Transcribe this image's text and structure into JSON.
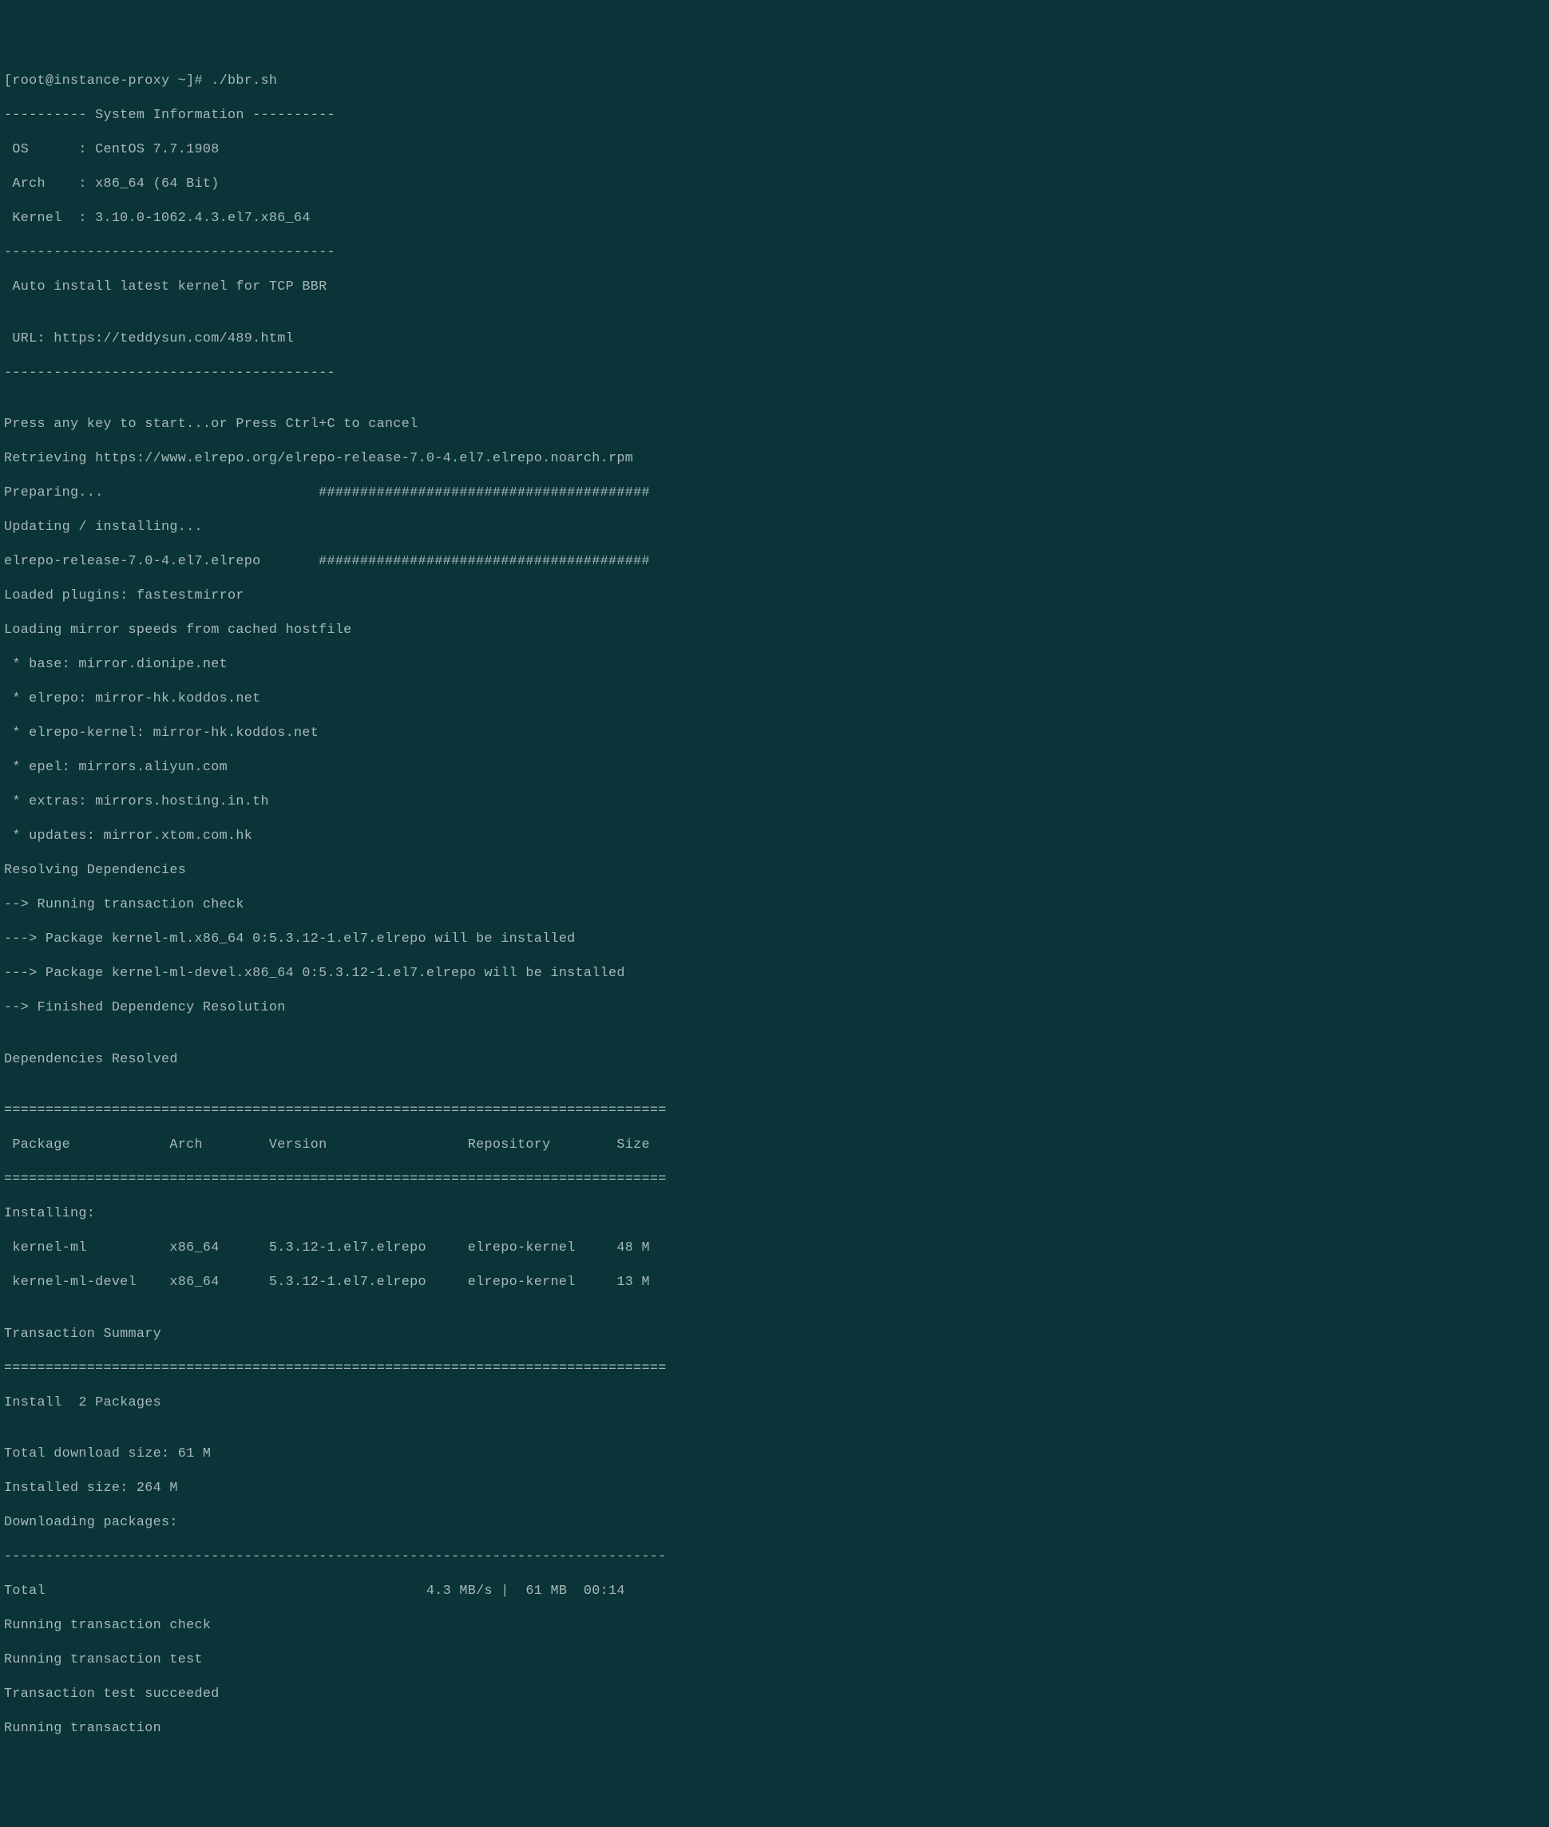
{
  "prompt": "[root@instance-proxy ~]# ./bbr.sh",
  "sysinfo_header": "---------- System Information ----------",
  "sysinfo_os": " OS      : CentOS 7.7.1908",
  "sysinfo_arch": " Arch    : x86_64 (64 Bit)",
  "sysinfo_kernel": " Kernel  : 3.10.0-1062.4.3.el7.x86_64",
  "divider40": "----------------------------------------",
  "auto_install": " Auto install latest kernel for TCP BBR",
  "blank": "",
  "url_line": " URL: https://teddysun.com/489.html",
  "press_key": "Press any key to start...or Press Ctrl+C to cancel",
  "retrieving": "Retrieving https://www.elrepo.org/elrepo-release-7.0-4.el7.elrepo.noarch.rpm",
  "preparing": "Preparing...                          ########################################",
  "updating": "Updating / installing...",
  "elrepo_release": "elrepo-release-7.0-4.el7.elrepo       ########################################",
  "loaded_plugins": "Loaded plugins: fastestmirror",
  "loading_mirror": "Loading mirror speeds from cached hostfile",
  "mirror_base": " * base: mirror.dionipe.net",
  "mirror_elrepo": " * elrepo: mirror-hk.koddos.net",
  "mirror_elrepo_kernel": " * elrepo-kernel: mirror-hk.koddos.net",
  "mirror_epel": " * epel: mirrors.aliyun.com",
  "mirror_extras": " * extras: mirrors.hosting.in.th",
  "mirror_updates": " * updates: mirror.xtom.com.hk",
  "resolving_deps": "Resolving Dependencies",
  "running_check": "--> Running transaction check",
  "pkg_kernel_ml": "---> Package kernel-ml.x86_64 0:5.3.12-1.el7.elrepo will be installed",
  "pkg_kernel_ml_devel": "---> Package kernel-ml-devel.x86_64 0:5.3.12-1.el7.elrepo will be installed",
  "finished_dep": "--> Finished Dependency Resolution",
  "deps_resolved": "Dependencies Resolved",
  "double_line": "================================================================================",
  "table_header": " Package            Arch        Version                 Repository        Size",
  "installing_label": "Installing:",
  "row_kernel_ml": " kernel-ml          x86_64      5.3.12-1.el7.elrepo     elrepo-kernel     48 M",
  "row_kernel_ml_devel": " kernel-ml-devel    x86_64      5.3.12-1.el7.elrepo     elrepo-kernel     13 M",
  "transaction_summary": "Transaction Summary",
  "install_2": "Install  2 Packages",
  "total_download": "Total download size: 61 M",
  "installed_size": "Installed size: 264 M",
  "downloading": "Downloading packages:",
  "dash_line": "--------------------------------------------------------------------------------",
  "total_speed": "Total                                              4.3 MB/s |  61 MB  00:14",
  "running_trans_check": "Running transaction check",
  "running_trans_test": "Running transaction test",
  "trans_test_succeeded": "Transaction test succeeded",
  "running_trans": "Running transaction"
}
